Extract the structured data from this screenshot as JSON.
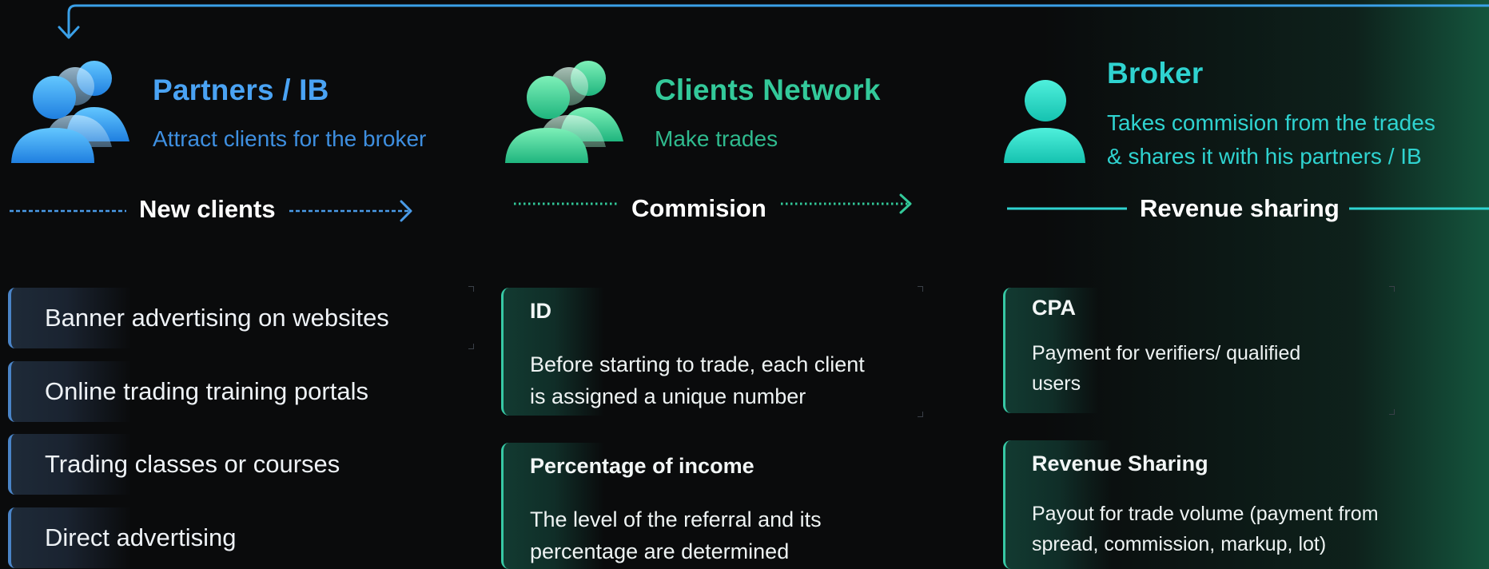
{
  "colors": {
    "partners": "#4aa3f4",
    "clients": "#33c99a",
    "broker": "#2fd3d0",
    "arrow_top": "#3aa0e8",
    "card_border": "#37c9a5",
    "item_border": "#4a84c7"
  },
  "icons": {
    "partners": "group-of-people-icon",
    "clients": "group-of-people-icon",
    "broker": "single-person-icon"
  },
  "columns": {
    "partners": {
      "title": "Partners / IB",
      "subtitle": "Attract clients for the broker",
      "flow_label": "New clients"
    },
    "clients": {
      "title": "Clients Network",
      "subtitle": "Make trades",
      "flow_label": "Commision"
    },
    "broker": {
      "title": "Broker",
      "subtitle_line1": "Takes commision from the trades",
      "subtitle_line2": "& shares it with his partners / IB",
      "flow_label": "Revenue sharing"
    }
  },
  "channels": [
    "Banner advertising on websites",
    "Online trading training portals",
    "Trading classes or courses",
    "Direct advertising"
  ],
  "client_cards": [
    {
      "title": "ID",
      "line1": "Before starting to trade, each client",
      "line2": "is assigned a unique number"
    },
    {
      "title": "Percentage of income",
      "line1": "The level of the referral and its",
      "line2": "percentage are determined"
    }
  ],
  "broker_cards": [
    {
      "title": "CPA",
      "line1": "Payment for verifiers/ qualified",
      "line2": "users"
    },
    {
      "title": "Revenue Sharing",
      "line1": "Payout for trade volume (payment from",
      "line2": "spread, commission, markup, lot)"
    }
  ]
}
